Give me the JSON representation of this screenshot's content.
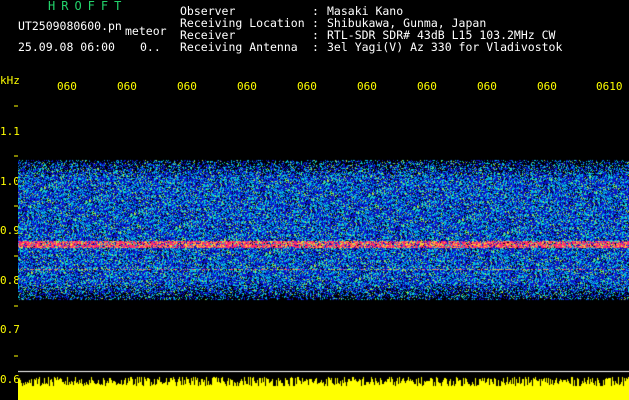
{
  "header": {
    "brand": "HROFFT",
    "filename": "UT2509080600.pn",
    "data_type": "meteor",
    "datetime": "25.09.08 06:00",
    "extra": "0.."
  },
  "meta": [
    {
      "label": "Observer",
      "value": "Masaki Kano"
    },
    {
      "label": "Receiving Location",
      "value": "Shibukawa, Gunma, Japan"
    },
    {
      "label": "Receiver",
      "value": "RTL-SDR SDR# 43dB L15 103.2MHz CW"
    },
    {
      "label": "Receiving Antenna",
      "value": "3el Yagi(V) Az 330 for Vladivostok"
    }
  ],
  "axes": {
    "y_unit": "kHz",
    "y_ticks": [
      "1.1",
      "1.0",
      "0.9",
      "0.8",
      "0.7",
      "0.6"
    ],
    "x_ticks": [
      "060",
      "060",
      "060",
      "060",
      "060",
      "060",
      "060",
      "060",
      "060",
      "0610"
    ]
  },
  "colors": {
    "axis": "#ffff00",
    "brand": "#22d36b",
    "signal_band": "#ff2a6d",
    "background": "#000000"
  }
}
